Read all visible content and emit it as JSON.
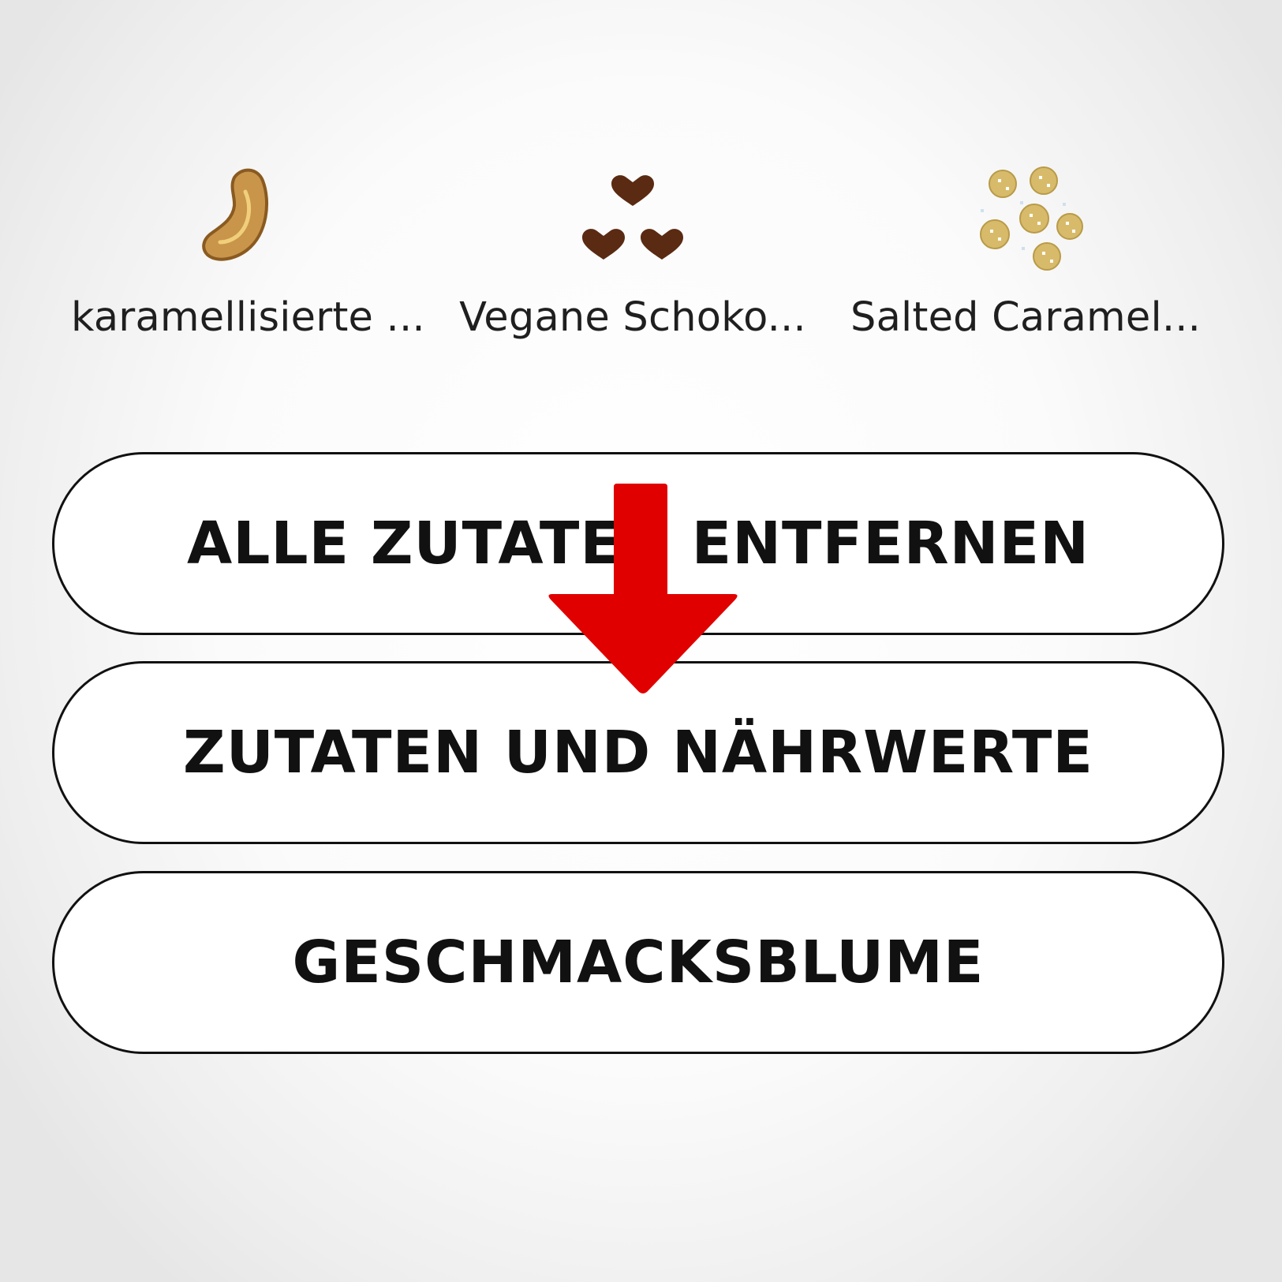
{
  "ingredients": [
    {
      "label": "karamellisierte ...",
      "icon": "cashew-icon"
    },
    {
      "label": "Vegane Schoko...",
      "icon": "chocolate-hearts-icon"
    },
    {
      "label": "Salted Caramel...",
      "icon": "caramel-crumbles-icon"
    }
  ],
  "buttons": {
    "remove_all": "ALLE ZUTATEN ENTFERNEN",
    "nutrition": "ZUTATEN UND NÄHRWERTE",
    "flavor_flower": "GESCHMACKSBLUME"
  },
  "colors": {
    "arrow": "#e00000",
    "cashew": "#c8954b",
    "chocolate": "#5a2a12",
    "crumble": "#d8bb6a",
    "border": "#111111"
  }
}
